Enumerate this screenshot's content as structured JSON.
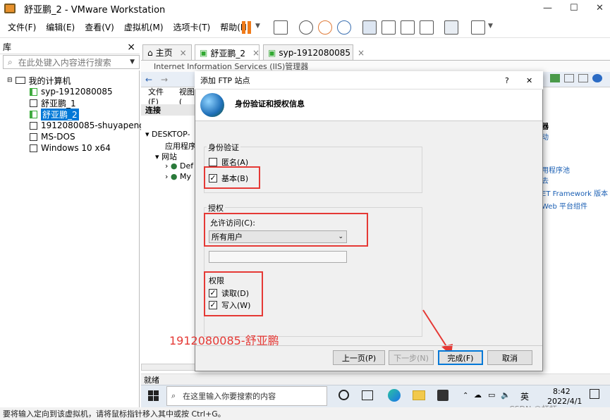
{
  "window": {
    "title": "舒亚鹏_2 - VMware Workstation",
    "minimize": "—",
    "maximize": "☐",
    "close": "✕"
  },
  "menu": [
    "文件(F)",
    "编辑(E)",
    "查看(V)",
    "虚拟机(M)",
    "选项卡(T)",
    "帮助(H)"
  ],
  "library": {
    "title": "库",
    "close": "×",
    "search_placeholder": "在此处键入内容进行搜索",
    "root": "我的计算机",
    "items": [
      "syp-1912080085",
      "舒亚鹏_1",
      "舒亚鹏_2",
      "1912080085-shuyapeng",
      "MS-DOS",
      "Windows 10 x64"
    ]
  },
  "tabs": [
    {
      "label": "主页",
      "close": "×"
    },
    {
      "label": "舒亚鹏_2",
      "close": "×"
    },
    {
      "label": "syp-1912080085",
      "close": "×"
    }
  ],
  "iis": {
    "title": "Internet Information Services (IIS)管理器",
    "menu_file": "文件(F)",
    "menu_view": "视图(",
    "connections": "连接",
    "tree": [
      "DESKTOP-",
      "应用程序",
      "网站",
      "Def",
      "My"
    ],
    "right_links": [
      "器",
      "动",
      "用程序池",
      "去",
      "ET Framework 版本",
      "Web 平台组件"
    ],
    "status": "就绪"
  },
  "taskbar": {
    "search_placeholder": "在这里输入你要搜索的内容",
    "time": "8:42",
    "date": "2022/4/1",
    "lang": "英",
    "watermark": "CSDN @杯杯."
  },
  "bottom_status": "要将输入定向到该虚拟机，请将鼠标指针移入其中或按 Ctrl+G。",
  "dialog": {
    "title": "添加 FTP 站点",
    "help": "?",
    "close": "✕",
    "header": "身份验证和授权信息",
    "auth_group": "身份验证",
    "anon_label": "匿名(A)",
    "anon_checked": false,
    "basic_label": "基本(B)",
    "basic_checked": true,
    "authz_group": "授权",
    "allow_label": "允许访问(C):",
    "allow_value": "所有用户",
    "perm_label": "权限",
    "read_label": "读取(D)",
    "read_checked": true,
    "write_label": "写入(W)",
    "write_checked": true,
    "btn_prev": "上一页(P)",
    "btn_next": "下一步(N)",
    "btn_finish": "完成(F)",
    "btn_cancel": "取消"
  },
  "annotation": "1912080085-舒亚鹏",
  "colors": {
    "highlight": "#e53935",
    "accent": "#0078d7"
  }
}
